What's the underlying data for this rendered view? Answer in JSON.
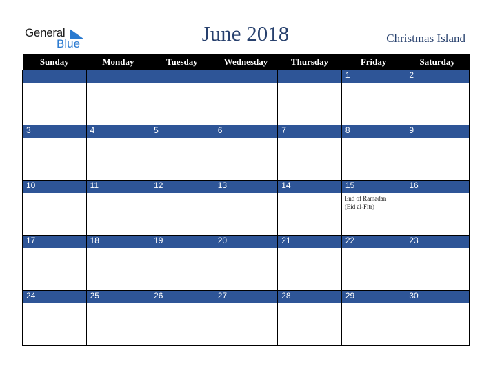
{
  "logo": {
    "general": "General",
    "blue": "Blue"
  },
  "header": {
    "title": "June 2018",
    "region": "Christmas Island"
  },
  "days": [
    "Sunday",
    "Monday",
    "Tuesday",
    "Wednesday",
    "Thursday",
    "Friday",
    "Saturday"
  ],
  "colors": {
    "datebar": "#2e5597",
    "title": "#27406d",
    "header_bg": "#000000"
  },
  "weeks": [
    {
      "dates": [
        "",
        "",
        "",
        "",
        "",
        "1",
        "2"
      ],
      "events": [
        "",
        "",
        "",
        "",
        "",
        "",
        ""
      ]
    },
    {
      "dates": [
        "3",
        "4",
        "5",
        "6",
        "7",
        "8",
        "9"
      ],
      "events": [
        "",
        "",
        "",
        "",
        "",
        "",
        ""
      ]
    },
    {
      "dates": [
        "10",
        "11",
        "12",
        "13",
        "14",
        "15",
        "16"
      ],
      "events": [
        "",
        "",
        "",
        "",
        "",
        "End of Ramadan (Eid al-Fitr)",
        ""
      ]
    },
    {
      "dates": [
        "17",
        "18",
        "19",
        "20",
        "21",
        "22",
        "23"
      ],
      "events": [
        "",
        "",
        "",
        "",
        "",
        "",
        ""
      ]
    },
    {
      "dates": [
        "24",
        "25",
        "26",
        "27",
        "28",
        "29",
        "30"
      ],
      "events": [
        "",
        "",
        "",
        "",
        "",
        "",
        ""
      ]
    }
  ]
}
